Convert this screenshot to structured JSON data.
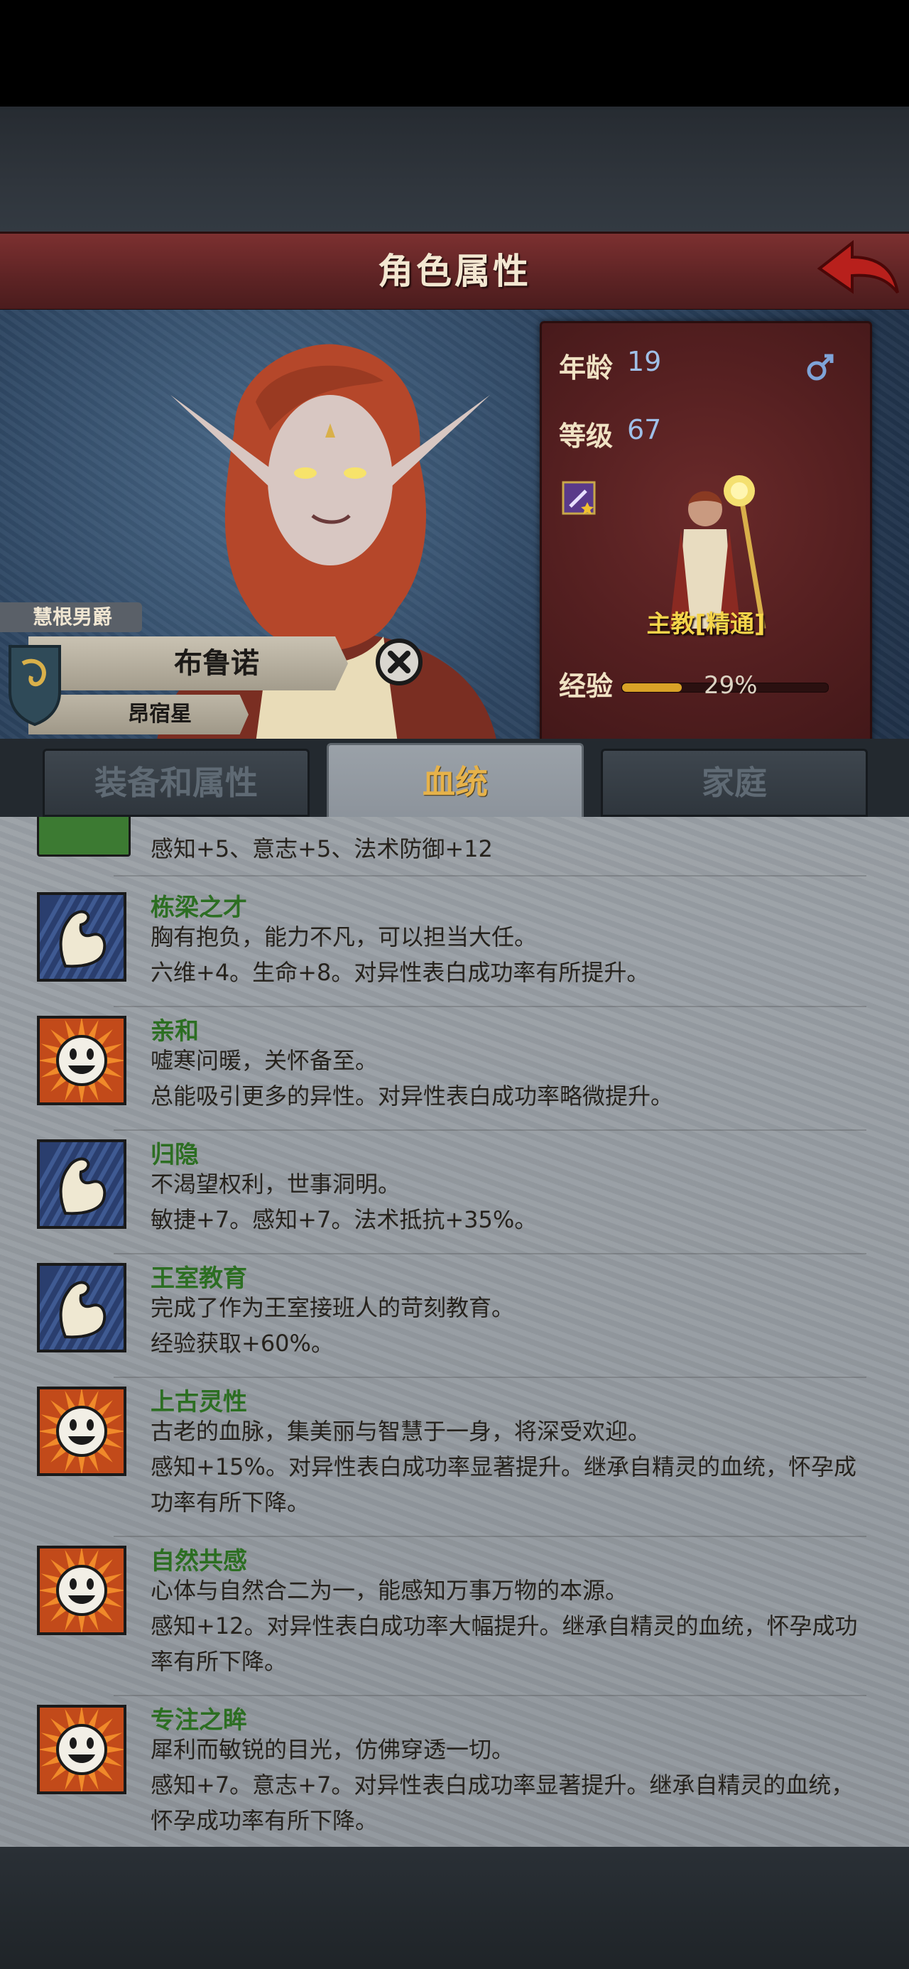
{
  "header": {
    "title": "角色属性"
  },
  "hero": {
    "title_tag": "慧根男爵",
    "name": "布鲁诺",
    "house": "昂宿星"
  },
  "stats": {
    "age_label": "年龄",
    "age_value": "19",
    "level_label": "等级",
    "level_value": "67",
    "class_name": "主教[精通]",
    "exp_label": "经验",
    "exp_percent": "29%",
    "exp_fraction": 0.29
  },
  "tabs": [
    {
      "label": "装备和属性",
      "active": false
    },
    {
      "label": "血统",
      "active": true
    },
    {
      "label": "家庭",
      "active": false
    }
  ],
  "traits_partial": {
    "desc": "感知+5、意志+5、法术防御+12"
  },
  "traits": [
    {
      "name": "栋梁之才",
      "icon": "arm-muscle-icon",
      "lines": [
        "胸有抱负，能力不凡，可以担当大任。",
        "六维+4。生命+8。对异性表白成功率有所提升。"
      ]
    },
    {
      "name": "亲和",
      "icon": "smiley-sun-icon",
      "lines": [
        "嘘寒问暖，关怀备至。",
        "总能吸引更多的异性。对异性表白成功率略微提升。"
      ]
    },
    {
      "name": "归隐",
      "icon": "arm-muscle-icon",
      "lines": [
        "不渴望权利，世事洞明。",
        "敏捷+7。感知+7。法术抵抗+35%。"
      ]
    },
    {
      "name": "王室教育",
      "icon": "arm-muscle-icon",
      "lines": [
        "完成了作为王室接班人的苛刻教育。",
        "经验获取+60%。"
      ]
    },
    {
      "name": "上古灵性",
      "icon": "smiley-sun-icon",
      "lines": [
        "古老的血脉，集美丽与智慧于一身，将深受欢迎。",
        "感知+15%。对异性表白成功率显著提升。继承自精灵的血统，怀孕成",
        "功率有所下降。"
      ]
    },
    {
      "name": "自然共感",
      "icon": "smiley-sun-icon",
      "lines": [
        "心体与自然合二为一，能感知万事万物的本源。",
        "感知+12。对异性表白成功率大幅提升。继承自精灵的血统，怀孕成功",
        "率有所下降。"
      ]
    },
    {
      "name": "专注之眸",
      "icon": "smiley-sun-icon",
      "lines": [
        "犀利而敏锐的目光，仿佛穿透一切。",
        "感知+7。意志+7。对异性表白成功率显著提升。继承自精灵的血统，",
        "怀孕成功率有所下降。"
      ]
    }
  ],
  "colors": {
    "header_red": "#5d2324",
    "trait_name_green": "#2c6e22",
    "class_gold": "#f4d44a",
    "active_tab_text": "#e6b24a",
    "stat_value_blue": "#9fc0e8"
  }
}
